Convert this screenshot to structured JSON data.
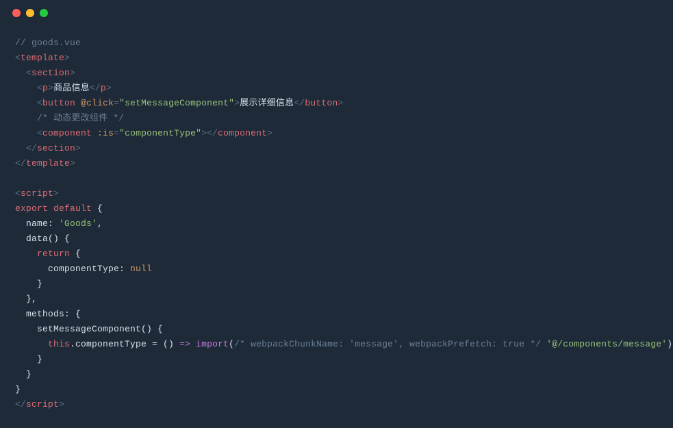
{
  "titlebar": {
    "dot_red": "close",
    "dot_yellow": "minimize",
    "dot_green": "zoom"
  },
  "code": {
    "l1": "// goods.vue",
    "l2_o": "<",
    "l2_tag": "template",
    "l2_c": ">",
    "l3_o": "<",
    "l3_tag": "section",
    "l3_c": ">",
    "l4_o": "<",
    "l4_tag": "p",
    "l4_c": ">",
    "l4_text": "商品信息",
    "l4_oc": "</",
    "l4_tag2": "p",
    "l4_cc": ">",
    "l5_o": "<",
    "l5_tag": "button",
    "l5_sp": " ",
    "l5_attr": "@click",
    "l5_eq": "=",
    "l5_val": "\"setMessageComponent\"",
    "l5_c": ">",
    "l5_text": "展示详细信息",
    "l5_oc": "</",
    "l5_tag2": "button",
    "l5_cc": ">",
    "l6": "/* 动态更改组件 */",
    "l7_o": "<",
    "l7_tag": "component",
    "l7_sp": " ",
    "l7_attr": ":is",
    "l7_eq": "=",
    "l7_val": "\"componentType\"",
    "l7_c": ">",
    "l7_oc": "</",
    "l7_tag2": "component",
    "l7_cc": ">",
    "l8_o": "</",
    "l8_tag": "section",
    "l8_c": ">",
    "l9_o": "</",
    "l9_tag": "template",
    "l9_c": ">",
    "l11_o": "<",
    "l11_tag": "script",
    "l11_c": ">",
    "l12_exp": "export",
    "l12_sp": " ",
    "l12_def": "default",
    "l12_brace": " {",
    "l13_name": "  name:",
    "l13_sp": " ",
    "l13_val": "'Goods'",
    "l13_comma": ",",
    "l14": "  data() {",
    "l15_ind": "    ",
    "l15_ret": "return",
    "l15_brace": " {",
    "l16_name": "      componentType:",
    "l16_sp": " ",
    "l16_val": "null",
    "l17": "    }",
    "l18": "  },",
    "l19": "  methods: {",
    "l20": "    setMessageComponent() {",
    "l21_ind": "      ",
    "l21_this": "this",
    "l21_dot": ".componentType = () ",
    "l21_arrow": "=>",
    "l21_sp": " ",
    "l21_imp": "import",
    "l21_paren": "(",
    "l21_com": "/* webpackChunkName: 'message', webpackPrefetch: true */",
    "l21_sp2": " ",
    "l21_str": "'@/components/message'",
    "l21_cparen": ")",
    "l22": "    }",
    "l23": "  }",
    "l24": "}",
    "l25_o": "</",
    "l25_tag": "script",
    "l25_c": ">"
  }
}
